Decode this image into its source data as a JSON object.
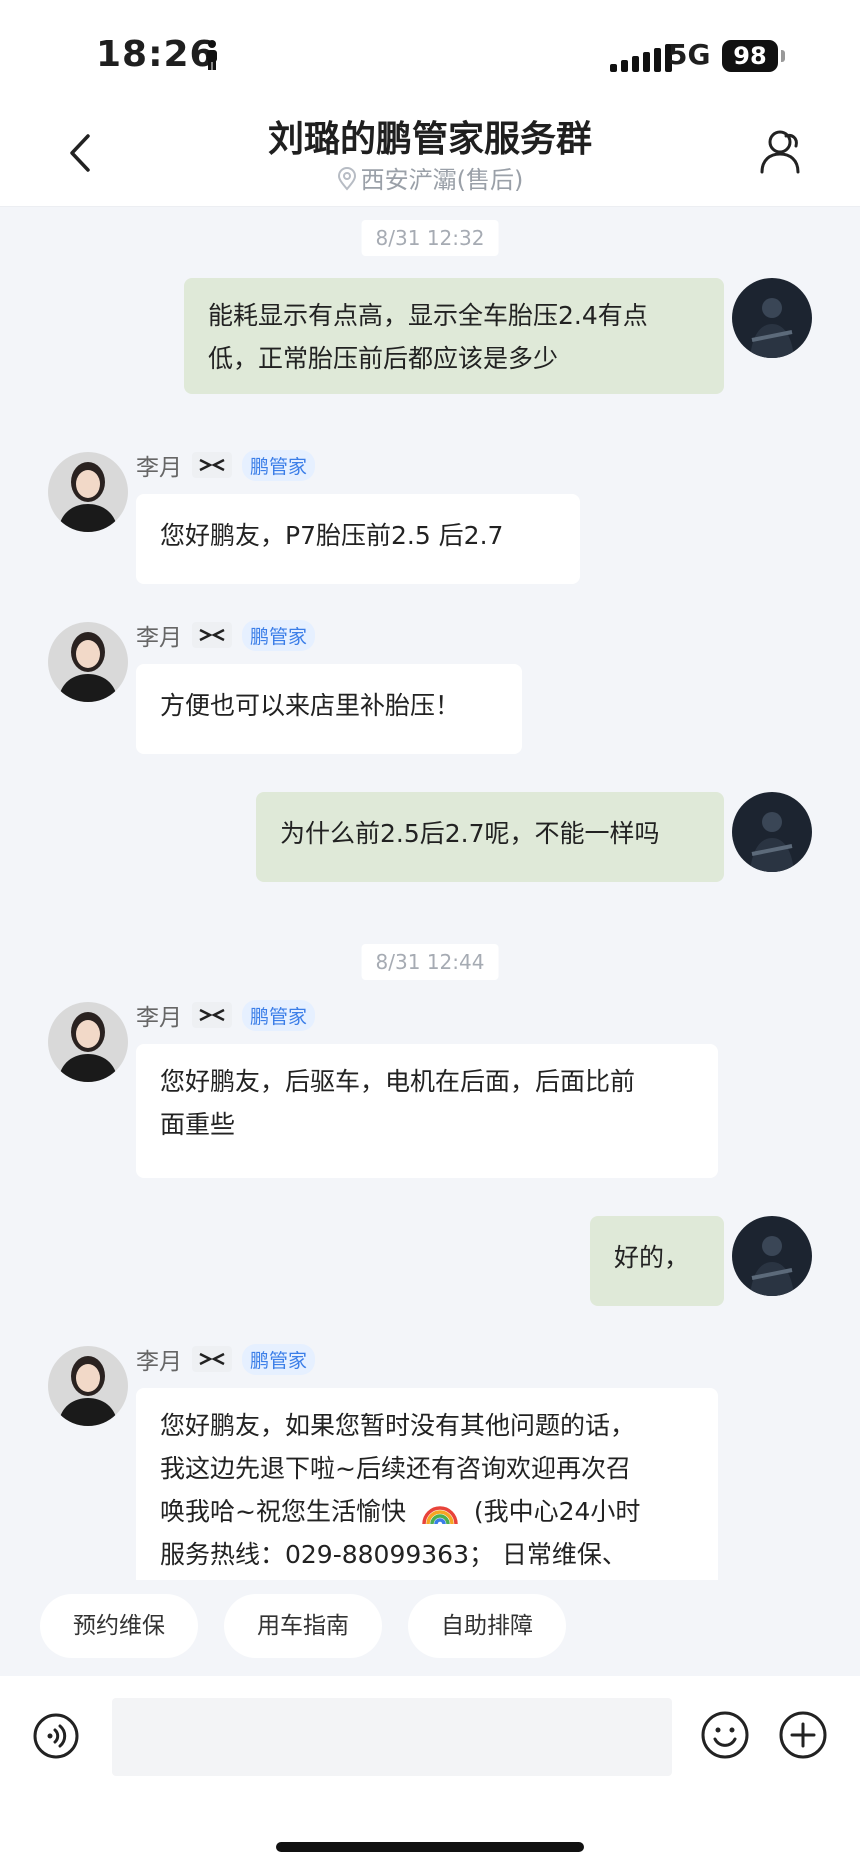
{
  "status_bar": {
    "time": "18:26",
    "network": "5G",
    "battery": "98"
  },
  "header": {
    "title": "刘璐的鹏管家服务群",
    "subtitle": "西安浐灞(售后)"
  },
  "messages": {
    "ts1": "8/31 12:32",
    "m1": {
      "line1": "能耗显示有点高，显示全车胎压2.4有点",
      "line2": "低，正常胎压前后都应该是多少"
    },
    "m2": {
      "sender": "李月",
      "role": "鹏管家",
      "text": "您好鹏友，P7胎压前2.5    后2.7"
    },
    "m3": {
      "sender": "李月",
      "role": "鹏管家",
      "text": "方便也可以来店里补胎压！"
    },
    "m4": {
      "text": "为什么前2.5后2.7呢，不能一样吗"
    },
    "ts2": "8/31 12:44",
    "m5": {
      "sender": "李月",
      "role": "鹏管家",
      "line1": "您好鹏友，后驱车，电机在后面，后面比前",
      "line2": "面重些"
    },
    "m6": {
      "text": "好的，"
    },
    "m7": {
      "sender": "李月",
      "role": "鹏管家",
      "line1": "您好鹏友，如果您暂时没有其他问题的话，",
      "line2": "我这边先退下啦~后续还有咨询欢迎再次召",
      "line3a": "唤我哈~祝您生活愉快",
      "line3b": "(我中心24小时",
      "line4": "服务热线：029-88099363；  日常维保、"
    }
  },
  "quick_actions": [
    "预约维保",
    "用车指南",
    "自助排障"
  ],
  "colors": {
    "outgoing_bubble": "#dfe9d8",
    "incoming_bubble": "#ffffff",
    "badge_text": "#3b7ee8",
    "background": "#f3f5f9"
  }
}
